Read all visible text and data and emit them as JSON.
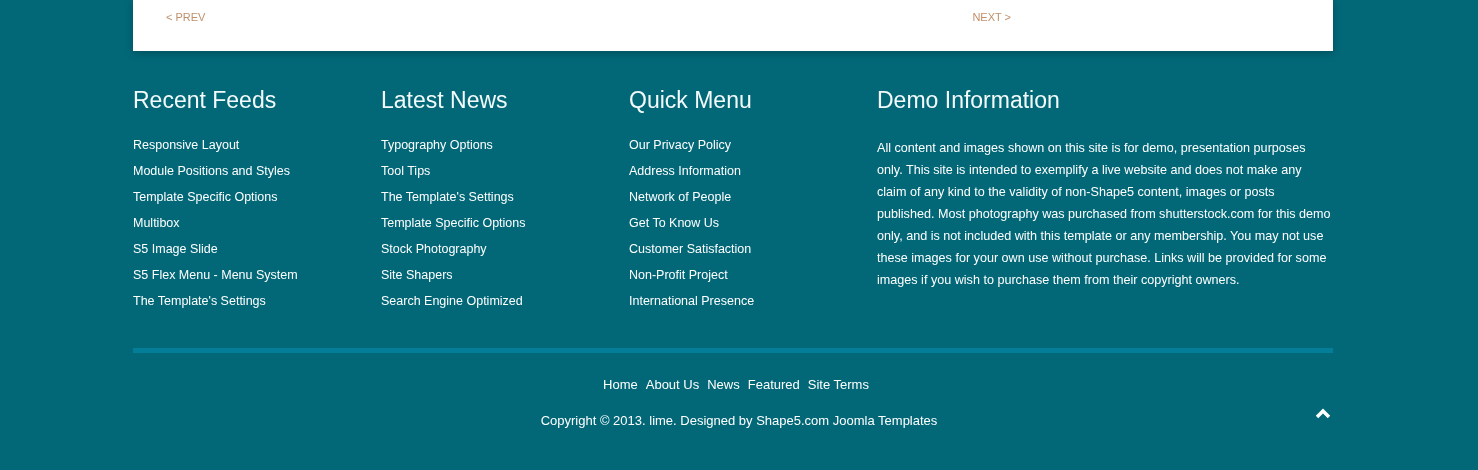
{
  "pager": {
    "prev": "< PREV",
    "next": "NEXT >"
  },
  "columns": [
    {
      "kind": "links",
      "title": "Recent Feeds",
      "items": [
        "Responsive Layout",
        "Module Positions and Styles",
        "Template Specific Options",
        "Multibox",
        "S5 Image Slide",
        "S5 Flex Menu - Menu System",
        "The Template's Settings"
      ]
    },
    {
      "kind": "links",
      "title": "Latest News",
      "items": [
        "Typography Options",
        "Tool Tips",
        "The Template's Settings",
        "Template Specific Options",
        "Stock Photography",
        "Site Shapers",
        "Search Engine Optimized"
      ]
    },
    {
      "kind": "links",
      "title": "Quick Menu",
      "items": [
        "Our Privacy Policy",
        "Address Information",
        "Network of People",
        "Get To Know Us",
        "Customer Satisfaction",
        "Non-Profit Project",
        "International Presence"
      ]
    },
    {
      "kind": "text",
      "title": "Demo Information",
      "text": "All content and images shown on this site is for demo, presentation purposes only. This site is intended to exemplify a live website and does not make any claim of any kind to the validity of non-Shape5 content, images or posts published. Most photography was purchased from shutterstock.com for this demo only, and is not included with this template or any membership. You may not use these images for your own use without purchase. Links will be provided for some images if you wish to purchase them from their copyright owners."
    }
  ],
  "footer_menu": [
    "Home",
    "About Us",
    "News",
    "Featured",
    "Site Terms"
  ],
  "copyright": "Copyright © 2013. lime. Designed by Shape5.com Joomla Templates"
}
